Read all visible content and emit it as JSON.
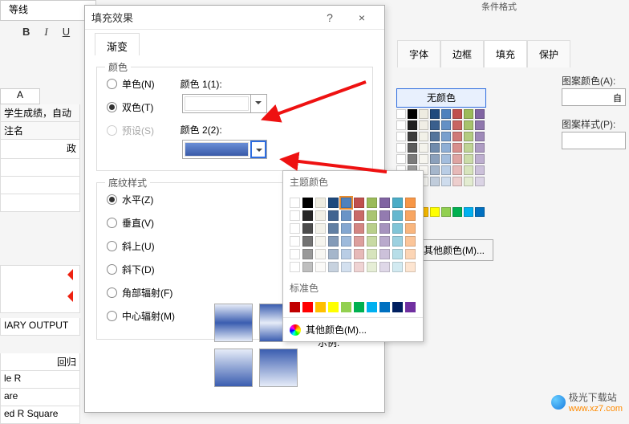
{
  "font_name": "等线",
  "toolbar": {
    "bold": "B",
    "italic": "I",
    "underline": "U"
  },
  "col_a": "A",
  "cells": {
    "title1": "学生成绩，自动",
    "title2": "注名",
    "col2_head": "政",
    "output": "IARY OUTPUT",
    "regress": "回归",
    "mr": "le R",
    "rsq": "are",
    "adj": "ed R Square"
  },
  "dialog": {
    "title": "填充效果",
    "help": "?",
    "close": "×",
    "tabs": {
      "gradient": "渐变"
    },
    "color_section": "颜色",
    "radios": {
      "single": "单色(N)",
      "double": "双色(T)",
      "preset": "预设(S)"
    },
    "color1_label": "颜色 1(1):",
    "color2_label": "颜色 2(2):",
    "pattern_section": "底纹样式",
    "patterns": {
      "horizontal": "水平(Z)",
      "vertical": "垂直(V)",
      "diag_up": "斜上(U)",
      "diag_down": "斜下(D)",
      "corner": "角部辐射(F)",
      "center": "中心辐射(M)"
    },
    "sample": "示例:"
  },
  "right": {
    "tabs": {
      "font": "字体",
      "border": "边框",
      "fill": "填充",
      "protect": "保护"
    },
    "no_color": "无颜色",
    "more_colors": "其他颜色(M)...",
    "pattern_color": "图案颜色(A):",
    "pattern_style": "图案样式(P):",
    "auto": "自"
  },
  "popup": {
    "theme_header": "主题颜色",
    "standard_header": "标准色",
    "more": "其他颜色(M)..."
  },
  "watermark": {
    "name": "极光下载站",
    "url": "www.xz7.com"
  },
  "cond": "条件格式"
}
